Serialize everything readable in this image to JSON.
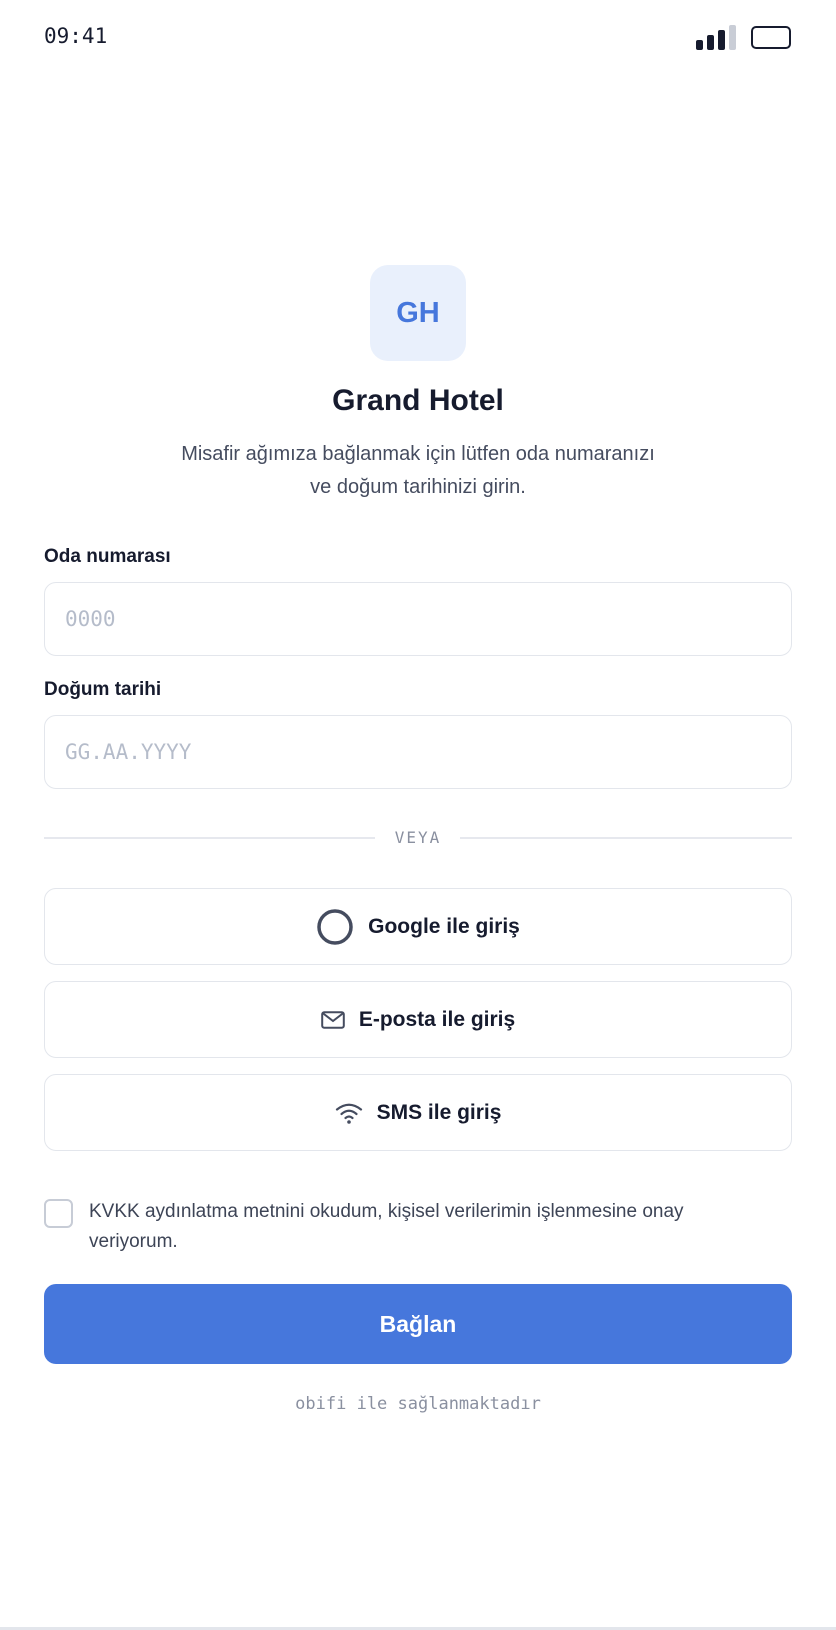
{
  "status_bar": {
    "time": "09:41"
  },
  "brand": {
    "logo_initials": "GH",
    "name": "Grand Hotel"
  },
  "intro": {
    "line1": "Misafir ağımıza bağlanmak için lütfen oda numaranızı",
    "line2": "ve doğum tarihinizi girin."
  },
  "room_field": {
    "label": "Oda numarası",
    "placeholder": "0000",
    "value": ""
  },
  "birth_field": {
    "label": "Doğum tarihi",
    "placeholder": "GG.AA.YYYY",
    "value": ""
  },
  "divider": {
    "label": "VEYA"
  },
  "alt_logins": [
    {
      "label": "Google ile giriş",
      "icon": "circle-icon"
    },
    {
      "label": "E-posta ile giriş",
      "icon": "mail-icon"
    },
    {
      "label": "SMS ile giriş",
      "icon": "wifi-icon"
    }
  ],
  "consent": {
    "text": "KVKK aydınlatma metnini okudum, kişisel verilerimin işlenmesine onay veriyorum.",
    "checked": false
  },
  "connect_button": {
    "label": "Bağlan"
  },
  "footer": {
    "powered_by": "obifi ile sağlanmaktadır"
  },
  "colors": {
    "primary": "#4677dc",
    "logo_bg": "#e9f0fc",
    "text": "#161b2e",
    "muted": "#8a90a0",
    "border": "#e3e6ec"
  }
}
